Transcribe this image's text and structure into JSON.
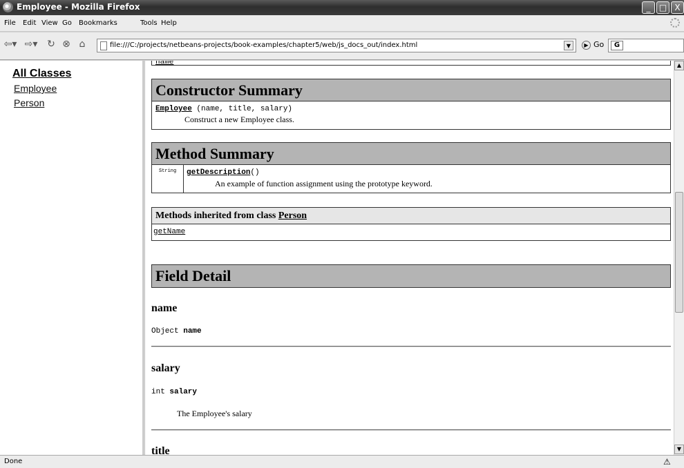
{
  "window": {
    "title": "Employee - Mozilla Firefox",
    "minimize": "_",
    "maximize": "□",
    "close": "X"
  },
  "menu": [
    "File",
    "Edit",
    "View",
    "Go",
    "Bookmarks",
    "Tools",
    "Help"
  ],
  "nav": {
    "url": "file:///C:/projects/netbeans-projects/book-examples/chapter5/web/js_docs_out/index.html",
    "go_label": "Go",
    "search_logo": "G"
  },
  "sidebar": {
    "heading": "All Classes",
    "classes": [
      "Employee",
      "Person"
    ]
  },
  "doc": {
    "top_field_link": "name",
    "constructor_summary": {
      "title": "Constructor Summary",
      "name": "Employee",
      "params": " (name, title, salary)",
      "description": "Construct a new Employee class."
    },
    "method_summary": {
      "title": "Method Summary",
      "return_type": "String",
      "name": "getDescription",
      "parens": "()",
      "description": "An example of function assignment using the prototype keyword."
    },
    "inherited": {
      "prefix": "Methods inherited from class ",
      "class_name": "Person",
      "methods": "getName"
    },
    "field_detail": {
      "title": "Field Detail",
      "fields": [
        {
          "name": "name",
          "type": "Object ",
          "sig_name": "name",
          "description": ""
        },
        {
          "name": "salary",
          "type": "int ",
          "sig_name": "salary",
          "description": "The Employee's salary"
        },
        {
          "name": "title"
        }
      ]
    }
  },
  "status": {
    "text": "Done"
  }
}
